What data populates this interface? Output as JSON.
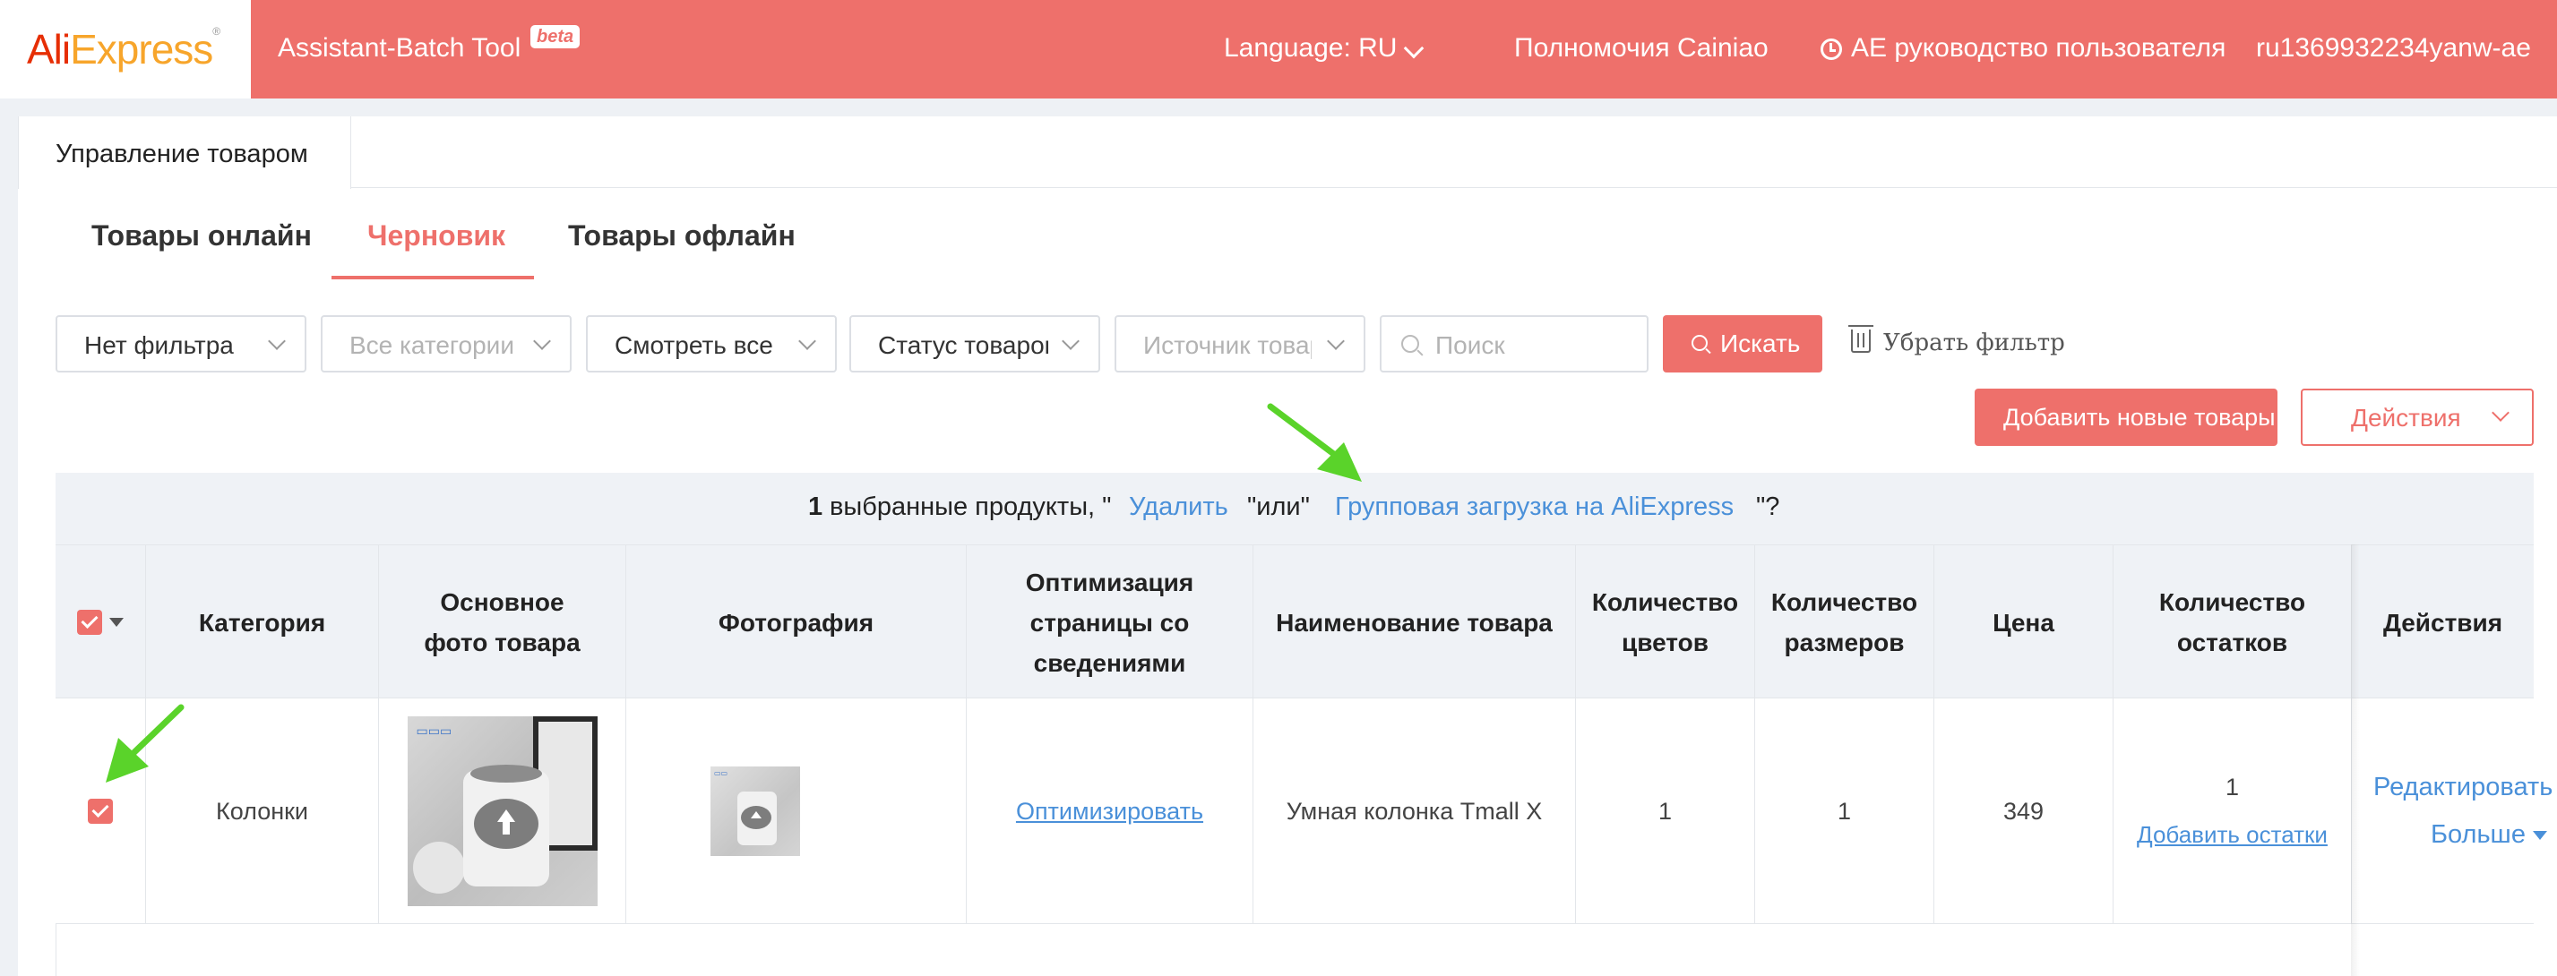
{
  "header": {
    "logo_ali": "Ali",
    "logo_express": "Express",
    "logo_reg": "®",
    "tool_title": "Assistant-Batch Tool",
    "beta": "beta",
    "language": "Language: RU",
    "cainiao": "Полномочия Cainiao",
    "guide": "AE руководство пользователя",
    "user": "ru1369932234yanw-ae"
  },
  "card_tab": "Управление товаром",
  "subtabs": [
    "Товары онлайн",
    "Черновик",
    "Товары офлайн"
  ],
  "active_subtab": "Черновик",
  "filters": {
    "filter": "Нет фильтра",
    "category": "Все категории",
    "view": "Смотреть все",
    "status": "Статус товаров",
    "source": "Источник товаров",
    "search_placeholder": "Поиск",
    "search_button": "Искать",
    "clear": "Убрать фильтр"
  },
  "buttons": {
    "add": "Добавить новые товары",
    "actions": "Действия"
  },
  "selection_bar": {
    "count": "1",
    "text1": "выбранные продукты, \"",
    "delete": "Удалить",
    "or": "\"или\"",
    "bulk_upload": "Групповая загрузка на AliExpress",
    "end": "\"?"
  },
  "table": {
    "headers": {
      "category": "Категория",
      "main_photo": "Основное фото товара",
      "photo": "Фотография",
      "optimization": "Оптимизация страницы со сведениями",
      "name": "Наименование товара",
      "colors": "Количество цветов",
      "sizes": "Количество размеров",
      "price": "Цена",
      "stock": "Количество остатков",
      "actions": "Действия"
    },
    "rows": [
      {
        "category": "Колонки",
        "optimize": "Оптимизировать",
        "name": "Умная колонка Tmall X",
        "colors": "1",
        "sizes": "1",
        "price": "349",
        "stock": "1",
        "add_stock": "Добавить остатки",
        "edit": "Редактировать",
        "more": "Больше"
      }
    ]
  },
  "colors": {
    "accent": "#ee706b",
    "link": "#4a90d9",
    "arrow": "#5ad32a"
  }
}
